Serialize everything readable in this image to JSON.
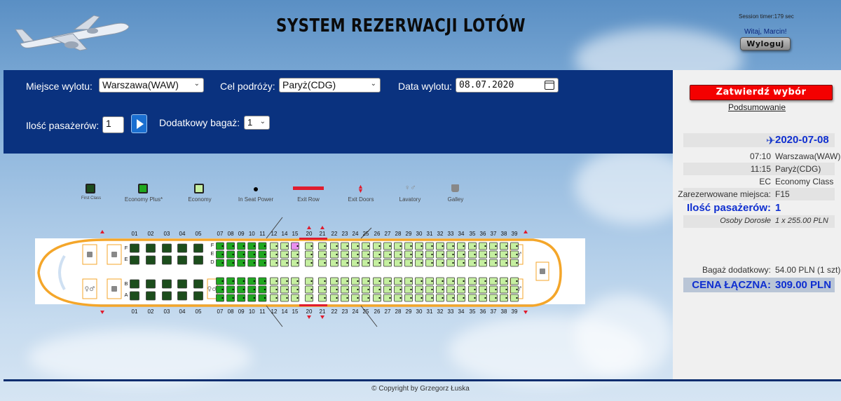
{
  "header": {
    "title": "SYSTEM REZERWACJI LOTÓW",
    "session_timer": "Session timer:179 sec",
    "welcome": "Witaj, Marcin!",
    "logout_label": "Wyloguj"
  },
  "form": {
    "departure_label": "Miejsce wylotu:",
    "departure_value": "Warszawa(WAW)",
    "destination_label": "Cel podróży:",
    "destination_value": "Paryż(CDG)",
    "date_label": "Data wylotu:",
    "date_value": "08.07.2020",
    "passengers_label": "Ilość pasażerów:",
    "passengers_value": "1",
    "baggage_label": "Dodatkowy bagaż:",
    "baggage_value": "1"
  },
  "legend": {
    "items": [
      {
        "label": "First Class",
        "icon": "first-class-seat-icon",
        "color": "#1c4d1c"
      },
      {
        "label": "Economy Plus*",
        "icon": "economy-plus-seat-icon",
        "color": "#1fa81f"
      },
      {
        "label": "Economy",
        "icon": "economy-seat-icon",
        "color": "#c5efa0"
      },
      {
        "label": "In Seat Power",
        "icon": "power-dot-icon",
        "color": "#000000"
      },
      {
        "label": "Exit Row",
        "icon": "exit-row-bar-icon",
        "color": "#e01c2e"
      },
      {
        "label": "Exit Doors",
        "icon": "exit-doors-icon",
        "color": "#e01c2e"
      },
      {
        "label": "Lavatory",
        "icon": "lavatory-icon",
        "color": "#888888"
      },
      {
        "label": "Galley",
        "icon": "galley-icon",
        "color": "#888888"
      }
    ]
  },
  "seatmap": {
    "row_numbers": [
      "01",
      "02",
      "03",
      "04",
      "05",
      "07",
      "08",
      "09",
      "10",
      "11",
      "12",
      "14",
      "15",
      "20",
      "21",
      "22",
      "23",
      "24",
      "25",
      "26",
      "27",
      "28",
      "29",
      "30",
      "31",
      "32",
      "33",
      "34",
      "35",
      "36",
      "37",
      "38",
      "39"
    ],
    "upper_letters_first": [
      "F",
      "E"
    ],
    "lower_letters_first": [
      "B",
      "A"
    ],
    "upper_letters": [
      "F",
      "E",
      "D"
    ],
    "lower_letters": [
      "C",
      "B",
      "A"
    ],
    "first_class_rows": [
      "01",
      "02",
      "03",
      "04",
      "05"
    ],
    "economy_plus_rows": [
      "07",
      "08",
      "09",
      "10",
      "11"
    ],
    "exit_rows": [
      "20",
      "21"
    ],
    "selected_seat": {
      "row": "15",
      "letter": "F"
    },
    "colors": {
      "first": "#1c4d1c",
      "plus": "#1fa81f",
      "economy": "#c5efa0",
      "selected": "#e98ff0",
      "fuselage": "#f4a62a",
      "exit": "#e01c2e"
    }
  },
  "summary": {
    "confirm_label": "Zatwierdź wybór",
    "summary_link": "Podsumowanie",
    "date": "2020-07-08",
    "dep_time": "07:10",
    "dep_city": "Warszawa(WAW)",
    "arr_time": "11:15",
    "arr_city": "Paryż(CDG)",
    "class_code": "EC",
    "class_name": "Economy Class",
    "reserved_label": "Zarezerwowane miejsca:",
    "reserved_value": "F15",
    "pax_label": "Ilość pasażerów:",
    "pax_value": "1",
    "adults_label": "Osoby Dorosłe",
    "adults_value": "1 x 255.00 PLN",
    "baggage_label": "Bagaż dodatkowy:",
    "baggage_value": "54.00 PLN (1 szt)",
    "total_label": "CENA ŁĄCZNA:",
    "total_value": "309.00 PLN"
  },
  "footer": {
    "copyright": "© Copyright by Grzegorz Łuska"
  }
}
